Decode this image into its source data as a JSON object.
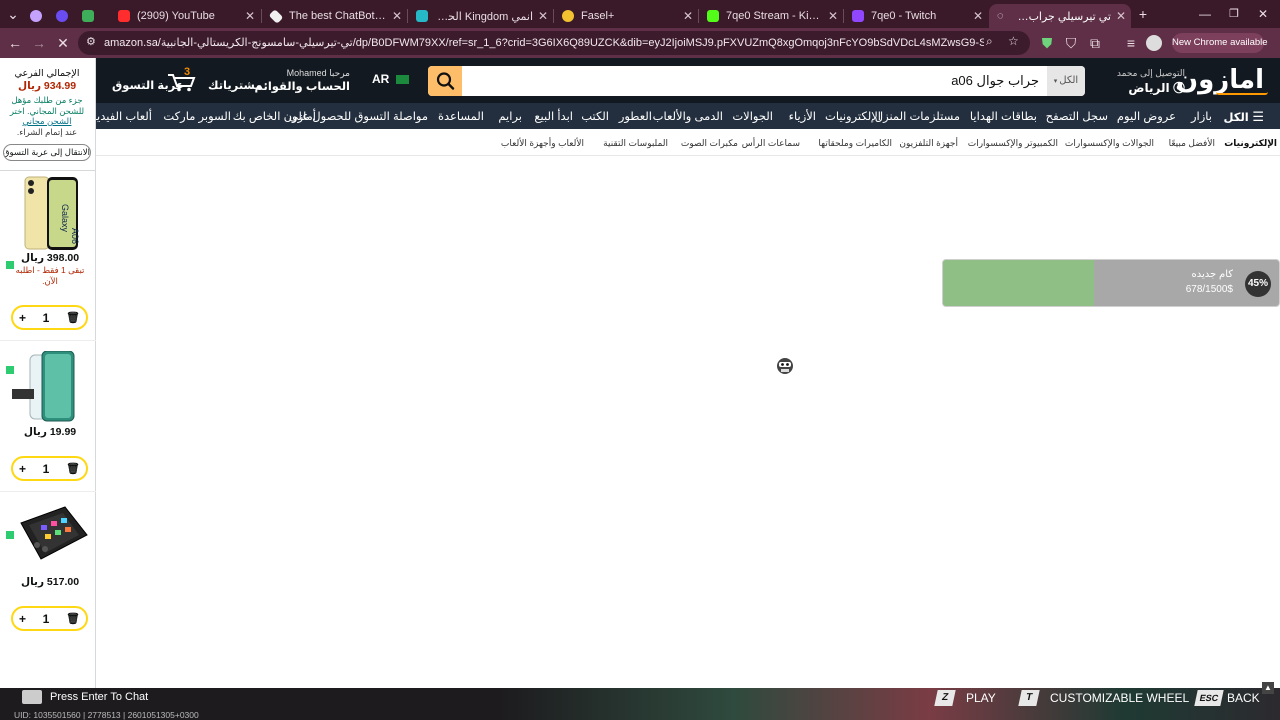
{
  "tabs": [
    {
      "title": "",
      "x": 0
    },
    {
      "title": "(2909) YouTube"
    },
    {
      "title": "The best ChatBot and Widg"
    },
    {
      "title": "انمي Kingdom الحلقة 10 مترجم"
    },
    {
      "title": "Fasel+"
    },
    {
      "title": "7qe0 Stream - Kick Dashbo"
    },
    {
      "title": "7qe0 - Twitch"
    },
    {
      "title": "تي تيرسيلي جراب شفاف لهاتف"
    }
  ],
  "browser": {
    "url": "amazon.sa/تي-تيرسيلي-سامسونج-الكريستالي-الجانبية/dp/B0DFWM79XX/ref=sr_1_6?crid=3G6IX6Q89UZCK&dib=eyJ2IjoiMSJ9.pFXVUZmQ8xgOmqoj3nFcYO9bSdVDcL4sMZwsG9-S7SIgo0zwVwD5DI_tADqSCwsznsF...",
    "new_chrome_label": "New Chrome available"
  },
  "header": {
    "logo": "امازون",
    "deliver_line1": "التوصيل إلى محمد",
    "deliver_line2": "الرياض",
    "search_category": "الكل",
    "search_value": "جراب جوال a06",
    "lang": "AR",
    "account_line1": "مرحبا Mohamed",
    "account_line2": "الحساب والقوائم",
    "orders": "مشترياتك",
    "cart_count": "3",
    "cart_label": "عربة التسوق"
  },
  "nav": {
    "all": "الكل",
    "items": [
      "بازار",
      "عروض اليوم",
      "سجل التصفح",
      "بطاقات الهدايا",
      "مستلزمات المنزل",
      "الإلكترونيات",
      "الأزياء",
      "الجوالات",
      "الدمى والألعاب",
      "العطور",
      "الكتب",
      "ابدأ البيع",
      "برايم",
      "المساعدة",
      "مواصلة التسوق للحصول على",
      "أمازون الخاص بك",
      "السوبر ماركت",
      "ألعاب الفيديو"
    ]
  },
  "subnav": {
    "items": [
      "الإلكترونيات",
      "الأفضل مبيعًا",
      "الجوالات والإكسسوارات",
      "الكمبيوتر والإكسسوارات",
      "أجهزة التلفزيون",
      "الكاميرات وملحقاتها",
      "سماعات الرأس",
      "مكبرات الصوت",
      "الملبوسات التقنية",
      "الألعاب وأجهزة الألعاب"
    ]
  },
  "cart": {
    "subtotal_label": "الإجمالي الفرعي",
    "subtotal": "934.99 ريال",
    "free_ship_line1": "جزء من طلبك مؤهل",
    "free_ship_line2": "للشحن المجاني. اختر",
    "free_ship_link": "الشحن مجاني",
    "free_ship_line3": "عند إتمام الشراء.",
    "go_to_cart": "الانتقال إلى عربة التسوق",
    "items": [
      {
        "price": "398.00 ريال",
        "note": "تبقى 1 فقط - اطلبه الآن.",
        "qty": "1"
      },
      {
        "price": "19.99 ريال",
        "qty": "1"
      },
      {
        "price": "517.00 ريال",
        "qty": "1"
      }
    ]
  },
  "goal": {
    "title": "كام جديده",
    "progress": "678/1500$",
    "percent": "45%",
    "fraction": 0.45
  },
  "overlay": {
    "chat_prompt": "Press Enter To Chat",
    "uid": "UID: 1035501560 | 2778513 | 2601051305+0300",
    "keys": [
      {
        "key": "Z",
        "label": "PLAY"
      },
      {
        "key": "T",
        "label": "CUSTOMIZABLE WHEEL"
      },
      {
        "key": "ESC",
        "label": "BACK"
      }
    ]
  },
  "colors": {
    "tabstrip": "#3a1a29",
    "toolbar": "#5e2f46",
    "amazon_dark": "#131921",
    "amazon_nav": "#232f3e",
    "search_button": "#febd69",
    "goal_fill": "#8fbf84",
    "goal_track": "#a8a8a8"
  }
}
